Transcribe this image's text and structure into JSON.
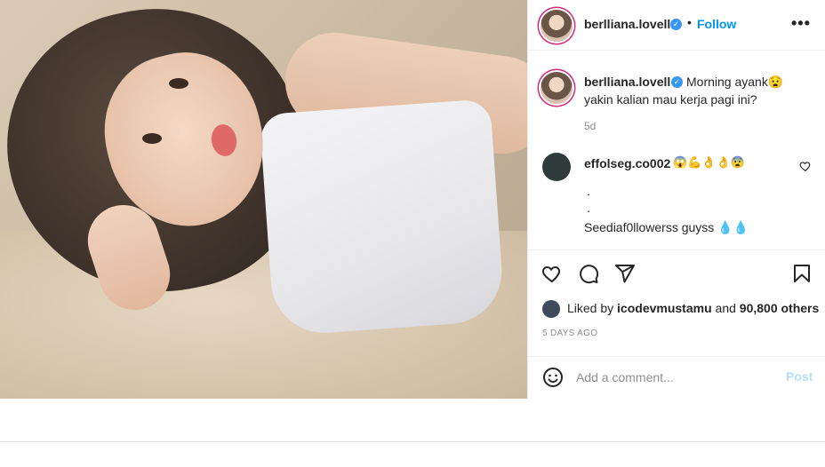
{
  "post": {
    "username": "berlliana.lovell",
    "follow_label": "Follow",
    "more_label": "•••",
    "separator": "•"
  },
  "caption": {
    "username": "berlliana.lovell",
    "text_line1": "Morning ayank😧",
    "text_line2": "yakin kalian mau kerja pagi ini?",
    "time": "5d"
  },
  "comment": {
    "username": "effolseg.co002",
    "emoji": "😱💪👌👌😨",
    "line1": ".",
    "line2": ".",
    "line3": "Seediaf0llowerss guyss 💧💧"
  },
  "likes": {
    "prefix": "Liked by ",
    "user": "icodevmustamu",
    "middle": " and ",
    "count": "90,800 others"
  },
  "timestamp": "5 DAYS AGO",
  "add_comment": {
    "placeholder": "Add a comment...",
    "post_label": "Post"
  },
  "colors": {
    "accent": "#0095f6",
    "post_disabled": "#b2dffc",
    "verified": "#3897f0"
  },
  "icons": [
    "verified-badge-icon",
    "more-options-icon",
    "heart-icon",
    "comment-icon",
    "share-icon",
    "bookmark-icon",
    "emoji-icon"
  ]
}
